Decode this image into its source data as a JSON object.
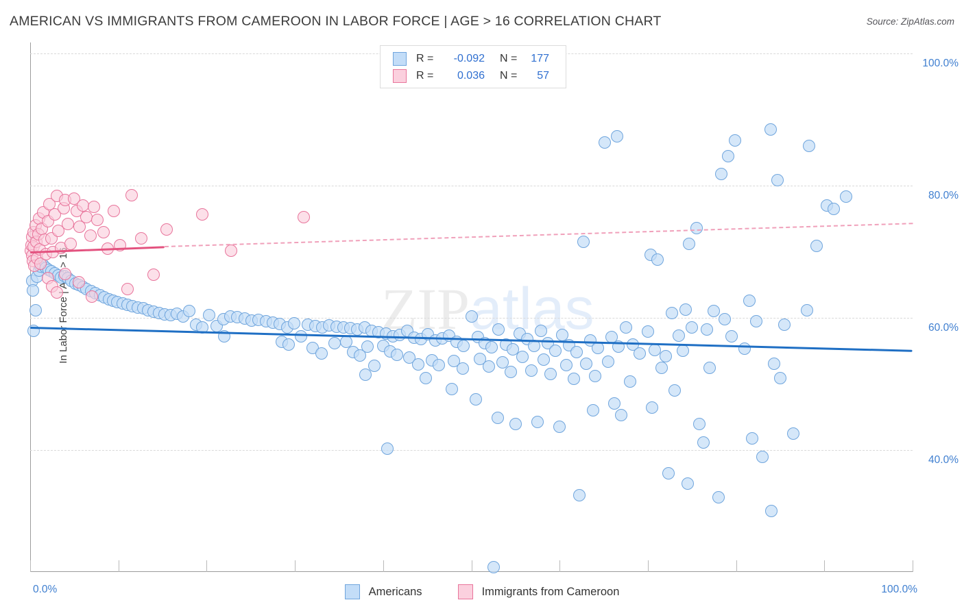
{
  "header": {
    "title": "AMERICAN VS IMMIGRANTS FROM CAMEROON IN LABOR FORCE | AGE > 16 CORRELATION CHART",
    "source": "Source: ZipAtlas.com"
  },
  "watermark": {
    "part1": "ZIP",
    "part2": "atlas"
  },
  "correlation_legend": {
    "rows": [
      {
        "series": "Americans",
        "color": "#c3ddf8",
        "r_label": "R =",
        "r_value": "-0.092",
        "n_label": "N =",
        "n_value": "177"
      },
      {
        "series": "Immigrants from Cameroon",
        "color": "#fbd0de",
        "r_label": "R =",
        "r_value": "0.036",
        "n_label": "N =",
        "n_value": "57"
      }
    ]
  },
  "series_legend": [
    {
      "label": "Americans",
      "color": "#c3ddf8"
    },
    {
      "label": "Immigrants from Cameroon",
      "color": "#fbd0de"
    }
  ],
  "chart_data": {
    "type": "scatter",
    "title": "AMERICAN VS IMMIGRANTS FROM CAMEROON IN LABOR FORCE | AGE > 16 CORRELATION CHART",
    "xlabel": "",
    "ylabel": "In Labor Force | Age > 16",
    "xlim": [
      0,
      100
    ],
    "ylim": [
      20,
      104
    ],
    "grid": true,
    "legend_position": "bottom-center",
    "x_ticks": [
      "0.0%",
      "100.0%"
    ],
    "x_tick_values": [
      0,
      100
    ],
    "y_ticks": [
      "40.0%",
      "60.0%",
      "80.0%",
      "100.0%"
    ],
    "y_tick_values": [
      40,
      60,
      80,
      100
    ],
    "series": [
      {
        "name": "Americans",
        "color": "#c3ddf8",
        "edge_color": "#6fa5dd",
        "r": -0.092,
        "n": 177,
        "trendline": {
          "style": "solid",
          "x0": 0,
          "y0": 58.7,
          "x1": 100,
          "y1": 55.2
        },
        "points": [
          [
            0.2,
            65.6
          ],
          [
            0.3,
            64.1
          ],
          [
            0.4,
            58.0
          ],
          [
            0.6,
            61.1
          ],
          [
            0.8,
            66.2
          ],
          [
            1.0,
            67.2
          ],
          [
            1.2,
            67.8
          ],
          [
            1.5,
            68.0
          ],
          [
            1.8,
            67.6
          ],
          [
            2.1,
            67.3
          ],
          [
            2.4,
            67.0
          ],
          [
            2.8,
            66.7
          ],
          [
            3.2,
            66.4
          ],
          [
            3.5,
            66.1
          ],
          [
            3.9,
            66.3
          ],
          [
            4.3,
            66.0
          ],
          [
            4.7,
            65.6
          ],
          [
            5.1,
            65.2
          ],
          [
            5.5,
            65.0
          ],
          [
            6.0,
            64.7
          ],
          [
            6.4,
            64.4
          ],
          [
            6.9,
            64.0
          ],
          [
            7.4,
            63.7
          ],
          [
            7.9,
            63.4
          ],
          [
            8.4,
            63.1
          ],
          [
            8.9,
            62.8
          ],
          [
            9.4,
            62.6
          ],
          [
            9.9,
            62.4
          ],
          [
            10.5,
            62.2
          ],
          [
            11.0,
            62.0
          ],
          [
            11.6,
            61.8
          ],
          [
            12.2,
            61.6
          ],
          [
            12.8,
            61.4
          ],
          [
            13.4,
            61.1
          ],
          [
            14.0,
            60.9
          ],
          [
            14.6,
            60.7
          ],
          [
            15.2,
            60.5
          ],
          [
            15.9,
            60.4
          ],
          [
            16.6,
            60.6
          ],
          [
            17.3,
            60.2
          ],
          [
            18.0,
            61.0
          ],
          [
            18.8,
            59.0
          ],
          [
            19.5,
            58.6
          ],
          [
            20.3,
            60.4
          ],
          [
            21.1,
            58.8
          ],
          [
            21.9,
            59.8
          ],
          [
            22.7,
            60.2
          ],
          [
            23.5,
            60.1
          ],
          [
            22.0,
            57.2
          ],
          [
            24.3,
            59.9
          ],
          [
            25.1,
            59.6
          ],
          [
            25.9,
            59.7
          ],
          [
            26.7,
            59.5
          ],
          [
            27.5,
            59.3
          ],
          [
            28.3,
            59.1
          ],
          [
            29.1,
            58.6
          ],
          [
            29.9,
            59.2
          ],
          [
            30.7,
            57.2
          ],
          [
            28.5,
            56.4
          ],
          [
            29.3,
            56.0
          ],
          [
            31.5,
            59.0
          ],
          [
            32.3,
            58.8
          ],
          [
            33.1,
            58.6
          ],
          [
            33.9,
            58.9
          ],
          [
            34.7,
            58.7
          ],
          [
            35.5,
            58.5
          ],
          [
            32.0,
            55.4
          ],
          [
            33.0,
            54.6
          ],
          [
            34.5,
            56.2
          ],
          [
            35.8,
            56.4
          ],
          [
            36.3,
            58.4
          ],
          [
            37.1,
            58.2
          ],
          [
            37.9,
            58.6
          ],
          [
            38.7,
            58.0
          ],
          [
            36.6,
            54.8
          ],
          [
            37.4,
            54.3
          ],
          [
            38.2,
            55.6
          ],
          [
            39.5,
            57.8
          ],
          [
            40.3,
            57.6
          ],
          [
            41.1,
            57.2
          ],
          [
            40.0,
            55.8
          ],
          [
            40.8,
            54.9
          ],
          [
            41.6,
            54.4
          ],
          [
            39.0,
            52.7
          ],
          [
            38.0,
            51.4
          ],
          [
            41.9,
            57.4
          ],
          [
            42.7,
            58.0
          ],
          [
            43.5,
            57.0
          ],
          [
            44.3,
            56.8
          ],
          [
            43.0,
            54.0
          ],
          [
            44.0,
            53.0
          ],
          [
            45.1,
            57.5
          ],
          [
            45.9,
            56.6
          ],
          [
            46.7,
            56.9
          ],
          [
            45.5,
            53.6
          ],
          [
            46.3,
            52.8
          ],
          [
            44.8,
            50.9
          ],
          [
            47.5,
            57.3
          ],
          [
            48.3,
            56.4
          ],
          [
            49.1,
            55.8
          ],
          [
            48.0,
            53.5
          ],
          [
            49.0,
            52.3
          ],
          [
            47.8,
            49.2
          ],
          [
            50.0,
            60.2
          ],
          [
            50.7,
            57.1
          ],
          [
            51.5,
            56.2
          ],
          [
            52.3,
            55.5
          ],
          [
            51.0,
            53.8
          ],
          [
            52.0,
            52.6
          ],
          [
            50.5,
            47.7
          ],
          [
            53.1,
            58.2
          ],
          [
            53.9,
            56.0
          ],
          [
            54.7,
            55.2
          ],
          [
            53.5,
            53.3
          ],
          [
            54.5,
            51.8
          ],
          [
            53.0,
            44.9
          ],
          [
            55.5,
            57.6
          ],
          [
            56.3,
            56.8
          ],
          [
            57.1,
            55.7
          ],
          [
            55.8,
            54.1
          ],
          [
            56.8,
            52.0
          ],
          [
            55.0,
            43.9
          ],
          [
            57.9,
            58.0
          ],
          [
            58.7,
            56.2
          ],
          [
            59.5,
            55.0
          ],
          [
            58.2,
            53.7
          ],
          [
            59.0,
            51.5
          ],
          [
            57.5,
            44.3
          ],
          [
            60.3,
            57.4
          ],
          [
            61.1,
            55.9
          ],
          [
            61.9,
            54.8
          ],
          [
            60.8,
            52.9
          ],
          [
            61.6,
            50.8
          ],
          [
            60.0,
            43.5
          ],
          [
            62.7,
            71.5
          ],
          [
            63.5,
            56.6
          ],
          [
            64.3,
            55.4
          ],
          [
            63.0,
            53.1
          ],
          [
            64.0,
            51.2
          ],
          [
            62.2,
            33.2
          ],
          [
            63.8,
            46.0
          ],
          [
            65.1,
            86.5
          ],
          [
            66.5,
            87.5
          ],
          [
            65.9,
            57.1
          ],
          [
            66.7,
            55.6
          ],
          [
            65.5,
            53.4
          ],
          [
            66.2,
            47.0
          ],
          [
            67.5,
            58.6
          ],
          [
            68.3,
            56.0
          ],
          [
            69.1,
            54.6
          ],
          [
            68.0,
            50.4
          ],
          [
            67.0,
            45.3
          ],
          [
            70.3,
            69.5
          ],
          [
            71.1,
            68.8
          ],
          [
            70.0,
            57.9
          ],
          [
            70.8,
            55.1
          ],
          [
            71.6,
            52.4
          ],
          [
            70.5,
            46.4
          ],
          [
            72.7,
            60.7
          ],
          [
            73.5,
            57.3
          ],
          [
            72.0,
            54.2
          ],
          [
            73.0,
            49.0
          ],
          [
            72.3,
            36.5
          ],
          [
            74.7,
            71.2
          ],
          [
            75.5,
            73.6
          ],
          [
            74.3,
            61.2
          ],
          [
            75.0,
            58.5
          ],
          [
            74.0,
            55.0
          ],
          [
            75.8,
            43.9
          ],
          [
            74.5,
            34.9
          ],
          [
            76.7,
            58.2
          ],
          [
            77.5,
            61.0
          ],
          [
            77.0,
            52.4
          ],
          [
            76.3,
            41.1
          ],
          [
            78.3,
            81.8
          ],
          [
            79.9,
            86.8
          ],
          [
            79.1,
            84.5
          ],
          [
            78.7,
            59.8
          ],
          [
            79.5,
            57.2
          ],
          [
            78.0,
            32.9
          ],
          [
            81.5,
            62.6
          ],
          [
            82.3,
            59.5
          ],
          [
            81.0,
            55.3
          ],
          [
            81.8,
            41.8
          ],
          [
            83.9,
            88.5
          ],
          [
            84.7,
            80.8
          ],
          [
            85.5,
            59.0
          ],
          [
            84.3,
            53.1
          ],
          [
            85.0,
            50.9
          ],
          [
            84.0,
            30.8
          ],
          [
            88.3,
            86.0
          ],
          [
            89.1,
            70.9
          ],
          [
            88.0,
            61.1
          ],
          [
            90.3,
            77.0
          ],
          [
            91.1,
            76.5
          ],
          [
            92.5,
            78.3
          ],
          [
            40.5,
            40.2
          ],
          [
            52.5,
            22.3
          ],
          [
            86.5,
            42.5
          ],
          [
            83.0,
            39.0
          ]
        ]
      },
      {
        "name": "Immigrants from Cameroon",
        "color": "#fbd0de",
        "edge_color": "#e8749b",
        "r": 0.036,
        "n": 57,
        "trendline": {
          "style": "solid-then-dashed",
          "x0": 0,
          "y0": 70.1,
          "x_break": 15.2,
          "y_break": 70.9,
          "x1": 100,
          "y1": 74.4
        },
        "points": [
          [
            0.1,
            70.2
          ],
          [
            0.15,
            71.0
          ],
          [
            0.2,
            69.4
          ],
          [
            0.25,
            72.2
          ],
          [
            0.3,
            68.6
          ],
          [
            0.35,
            73.0
          ],
          [
            0.4,
            70.8
          ],
          [
            0.5,
            67.9
          ],
          [
            0.6,
            74.0
          ],
          [
            0.7,
            71.5
          ],
          [
            0.8,
            69.0
          ],
          [
            0.9,
            72.6
          ],
          [
            1.0,
            75.0
          ],
          [
            1.1,
            70.4
          ],
          [
            1.2,
            68.2
          ],
          [
            1.3,
            73.5
          ],
          [
            1.5,
            76.0
          ],
          [
            1.6,
            71.8
          ],
          [
            1.8,
            69.6
          ],
          [
            2.0,
            74.6
          ],
          [
            2.2,
            77.2
          ],
          [
            2.4,
            72.0
          ],
          [
            2.6,
            70.0
          ],
          [
            2.8,
            75.6
          ],
          [
            3.0,
            78.4
          ],
          [
            3.2,
            73.2
          ],
          [
            3.5,
            70.6
          ],
          [
            3.8,
            76.6
          ],
          [
            4.0,
            77.8
          ],
          [
            4.3,
            74.2
          ],
          [
            4.6,
            71.2
          ],
          [
            5.0,
            78.0
          ],
          [
            5.3,
            76.2
          ],
          [
            5.6,
            73.8
          ],
          [
            6.0,
            77.0
          ],
          [
            6.4,
            75.2
          ],
          [
            6.8,
            72.4
          ],
          [
            7.2,
            76.8
          ],
          [
            7.6,
            74.8
          ],
          [
            2.0,
            66.0
          ],
          [
            2.5,
            64.8
          ],
          [
            3.0,
            63.8
          ],
          [
            4.0,
            66.6
          ],
          [
            5.5,
            65.4
          ],
          [
            7.0,
            63.2
          ],
          [
            8.3,
            73.0
          ],
          [
            8.8,
            70.5
          ],
          [
            9.5,
            76.2
          ],
          [
            10.2,
            71.0
          ],
          [
            11.5,
            78.6
          ],
          [
            11.0,
            64.4
          ],
          [
            12.6,
            72.0
          ],
          [
            14.0,
            66.5
          ],
          [
            15.5,
            73.4
          ],
          [
            19.5,
            75.6
          ],
          [
            22.8,
            70.2
          ],
          [
            31.0,
            75.2
          ]
        ]
      }
    ]
  }
}
